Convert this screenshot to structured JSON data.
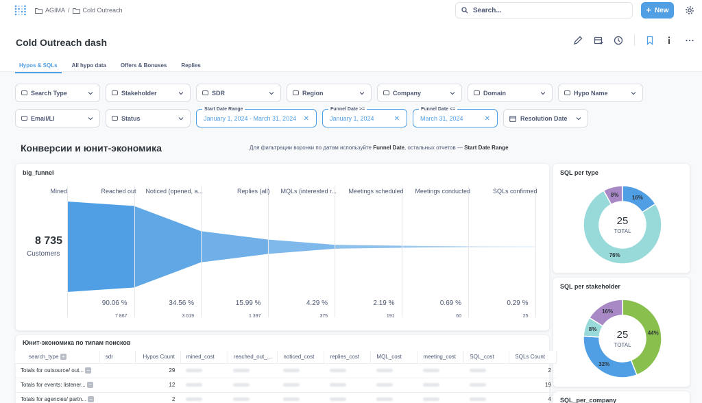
{
  "breadcrumbs": [
    "AGIMA",
    "/",
    "Cold Outreach"
  ],
  "search": {
    "label": "Search..."
  },
  "new_button": "New",
  "dashboard": {
    "title": "Cold Outreach dash"
  },
  "tabs": [
    {
      "label": "Hypos & SQLs",
      "active": true
    },
    {
      "label": "All hypo data",
      "active": false
    },
    {
      "label": "Offers & Bonuses",
      "active": false
    },
    {
      "label": "Replies",
      "active": false
    }
  ],
  "filters_row1": [
    "Search Type",
    "Stakeholder",
    "SDR",
    "Region",
    "Company",
    "Domain",
    "Hypo Name"
  ],
  "filters_row2": {
    "email": "Email/LI",
    "status": "Status",
    "start_date": {
      "label": "Start Date Range",
      "value": "January 1, 2024 - March 31, 2024"
    },
    "funnel_from": {
      "label": "Funnel Date >=",
      "value": "January 1, 2024"
    },
    "funnel_to": {
      "label": "Funnel Date <=",
      "value": "March 31, 2024"
    },
    "resolution": "Resolution Date"
  },
  "section": {
    "title": "Конверсии и юнит-экономика",
    "note_prefix": "Для фильтрации воронки по датам используйте ",
    "note_b1": "Funnel Date",
    "note_mid": ", остальных отчетов — ",
    "note_b2": "Start Date Range"
  },
  "funnel": {
    "title": "big_funnel",
    "total": "8 735",
    "total_label": "Customers",
    "stages": [
      {
        "label": "Mined",
        "pct": "",
        "count": ""
      },
      {
        "label": "Reached out",
        "pct": "90.06 %",
        "count": "7 867"
      },
      {
        "label": "Noticed (opened, a...",
        "pct": "34.56 %",
        "count": "3 019"
      },
      {
        "label": "Replies (all)",
        "pct": "15.99 %",
        "count": "1 397"
      },
      {
        "label": "MQLs (interested r...",
        "pct": "4.29 %",
        "count": "375"
      },
      {
        "label": "Meetings scheduled",
        "pct": "2.19 %",
        "count": "191"
      },
      {
        "label": "Meetings conducted",
        "pct": "0.69 %",
        "count": "60"
      },
      {
        "label": "SQLs confirmed",
        "pct": "0.29 %",
        "count": "25"
      }
    ],
    "color": "#509ee3"
  },
  "sql_per_type": {
    "title": "SQL per type",
    "total": "25",
    "total_label": "TOTAL",
    "slices": [
      {
        "label": "16%",
        "value": 16,
        "color": "#509ee3"
      },
      {
        "label": "76%",
        "value": 76,
        "color": "#98d9d9"
      },
      {
        "label": "8%",
        "value": 8,
        "color": "#a989c5"
      }
    ]
  },
  "sql_per_stakeholder": {
    "title": "SQL per stakeholder",
    "total": "25",
    "total_label": "TOTAL",
    "slices": [
      {
        "label": "44%",
        "value": 44,
        "color": "#88bf4d"
      },
      {
        "label": "32%",
        "value": 32,
        "color": "#509ee3"
      },
      {
        "label": "8%",
        "value": 8,
        "color": "#98d9d9"
      },
      {
        "label": "16%",
        "value": 16,
        "color": "#a989c5"
      }
    ]
  },
  "sql_per_company": {
    "title": "SQL_per_company"
  },
  "unit_table": {
    "title": "Юнит-экономика по типам поисков",
    "columns": [
      "search_type",
      "sdr",
      "Hypos Count",
      "mined_cost",
      "reached_out_...",
      "noticed_cost",
      "replies_cost",
      "MQL_cost",
      "meeting_cost",
      "SQL_cost",
      "SQLs Count"
    ],
    "rows": [
      {
        "name": "Totals for outsource/ out...",
        "hypos": "29",
        "sqls": "2"
      },
      {
        "name": "Totals for events: listener...",
        "hypos": "12",
        "sqls": "19"
      },
      {
        "name": "Totals for agencies/ partn...",
        "hypos": "2",
        "sqls": "4"
      }
    ]
  }
}
